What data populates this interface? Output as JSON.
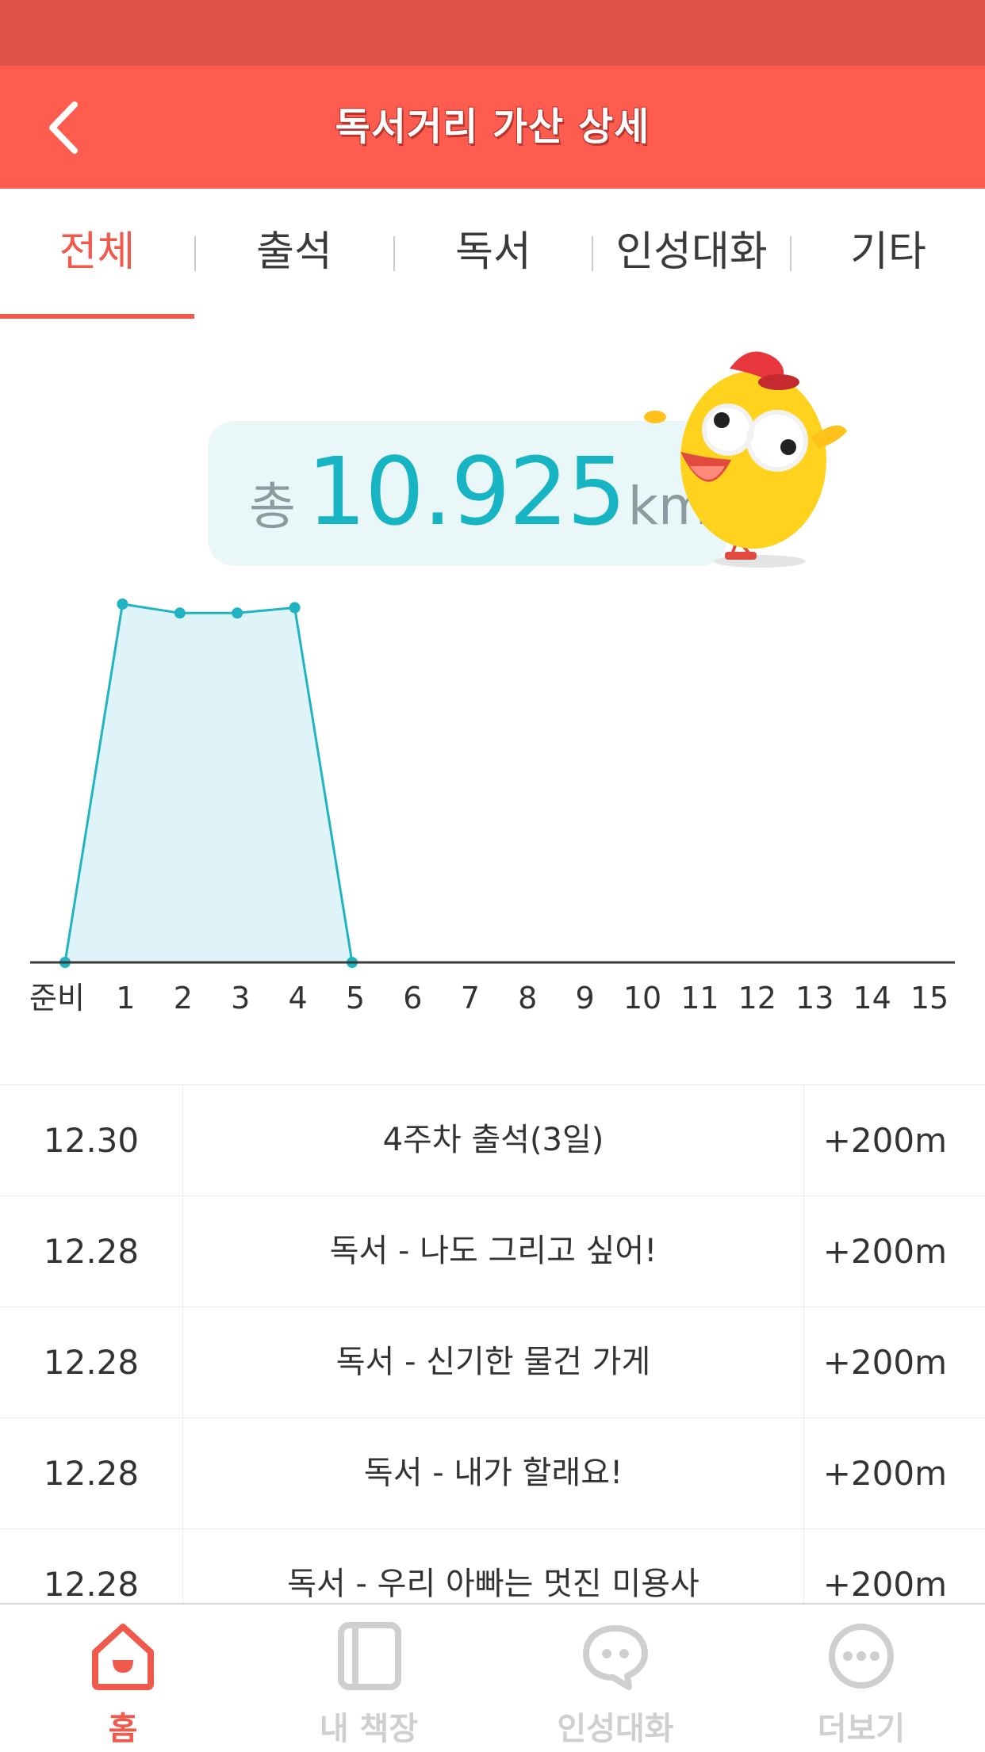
{
  "header": {
    "title": "독서거리 가산 상세"
  },
  "tabs": [
    {
      "label": "전체",
      "active": true
    },
    {
      "label": "출석",
      "active": false
    },
    {
      "label": "독서",
      "active": false
    },
    {
      "label": "인성대화",
      "active": false
    },
    {
      "label": "기타",
      "active": false
    }
  ],
  "summary": {
    "label": "총",
    "value": "10.925",
    "unit": "km"
  },
  "chart_data": {
    "type": "area",
    "categories": [
      "준비",
      "1",
      "2",
      "3",
      "4",
      "5",
      "6",
      "7",
      "8",
      "9",
      "10",
      "11",
      "12",
      "13",
      "14",
      "15"
    ],
    "series": [
      {
        "values": [
          0,
          1.0,
          0.975,
          0.975,
          0.99,
          0
        ]
      }
    ],
    "ylim": [
      0,
      1
    ],
    "grid": false,
    "colors": {
      "line": "#1fb3c3",
      "fill": "#dff4f8",
      "axis": "#3a3a3a"
    }
  },
  "records": [
    {
      "date": "12.30",
      "desc": "4주차 출석(3일)",
      "amount": "+200m"
    },
    {
      "date": "12.28",
      "desc": "독서 - 나도 그리고 싶어!",
      "amount": "+200m"
    },
    {
      "date": "12.28",
      "desc": "독서 - 신기한 물건 가게",
      "amount": "+200m"
    },
    {
      "date": "12.28",
      "desc": "독서 - 내가 할래요!",
      "amount": "+200m"
    },
    {
      "date": "12.28",
      "desc": "독서 - 우리 아빠는 멋진 미용사",
      "amount": "+200m"
    }
  ],
  "nav": [
    {
      "label": "홈",
      "icon": "home-icon",
      "active": true
    },
    {
      "label": "내 책장",
      "icon": "bookshelf-icon",
      "active": false
    },
    {
      "label": "인성대화",
      "icon": "chat-icon",
      "active": false
    },
    {
      "label": "더보기",
      "icon": "more-icon",
      "active": false
    }
  ],
  "colors": {
    "accent": "#fd5c4f",
    "status_bar": "#e0534a",
    "teal": "#17b4c4"
  }
}
